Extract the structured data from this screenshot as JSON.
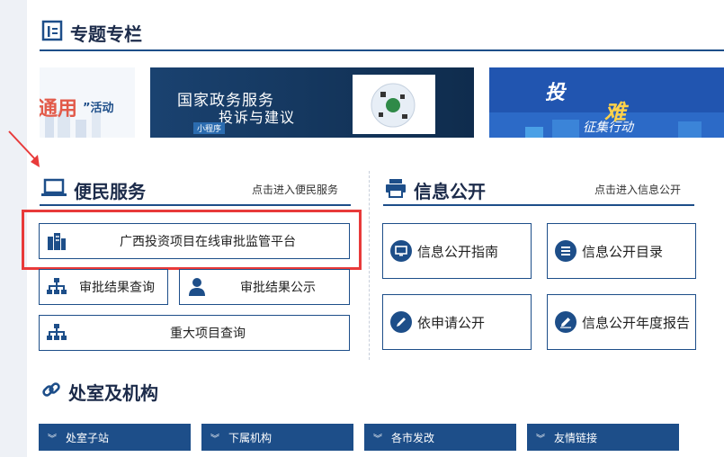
{
  "special": {
    "title": "专题专栏",
    "banner1": {
      "text_a": "通用",
      "text_b": "”活动"
    },
    "banner2": {
      "line1": "国家政务服务",
      "line2": "投诉与建议",
      "tag": "小程序"
    },
    "banner3": {
      "t1": "投",
      "t2": "难",
      "t3": "征集行动"
    }
  },
  "convenience": {
    "title": "便民服务",
    "more": "点击进入便民服务",
    "items": [
      {
        "label": "广西投资项目在线审批监管平台",
        "icon": "buildings-icon"
      },
      {
        "label": "审批结果查询",
        "icon": "org-chart-icon"
      },
      {
        "label": "审批结果公示",
        "icon": "person-icon"
      },
      {
        "label": "重大项目查询",
        "icon": "org-chart-icon"
      }
    ]
  },
  "info": {
    "title": "信息公开",
    "more": "点击进入信息公开",
    "items": [
      {
        "label": "信息公开指南",
        "icon": "monitor-icon"
      },
      {
        "label": "信息公开目录",
        "icon": "list-icon"
      },
      {
        "label": "依申请公开",
        "icon": "pen-icon"
      },
      {
        "label": "信息公开年度报告",
        "icon": "edit-icon"
      }
    ]
  },
  "offices": {
    "title": "处室及机构",
    "tabs": [
      "处室子站",
      "下属机构",
      "各市发改",
      "友情链接"
    ]
  },
  "colors": {
    "primary": "#1d4e89",
    "highlight": "#e83a3a",
    "arrow": "#e83a3a"
  }
}
